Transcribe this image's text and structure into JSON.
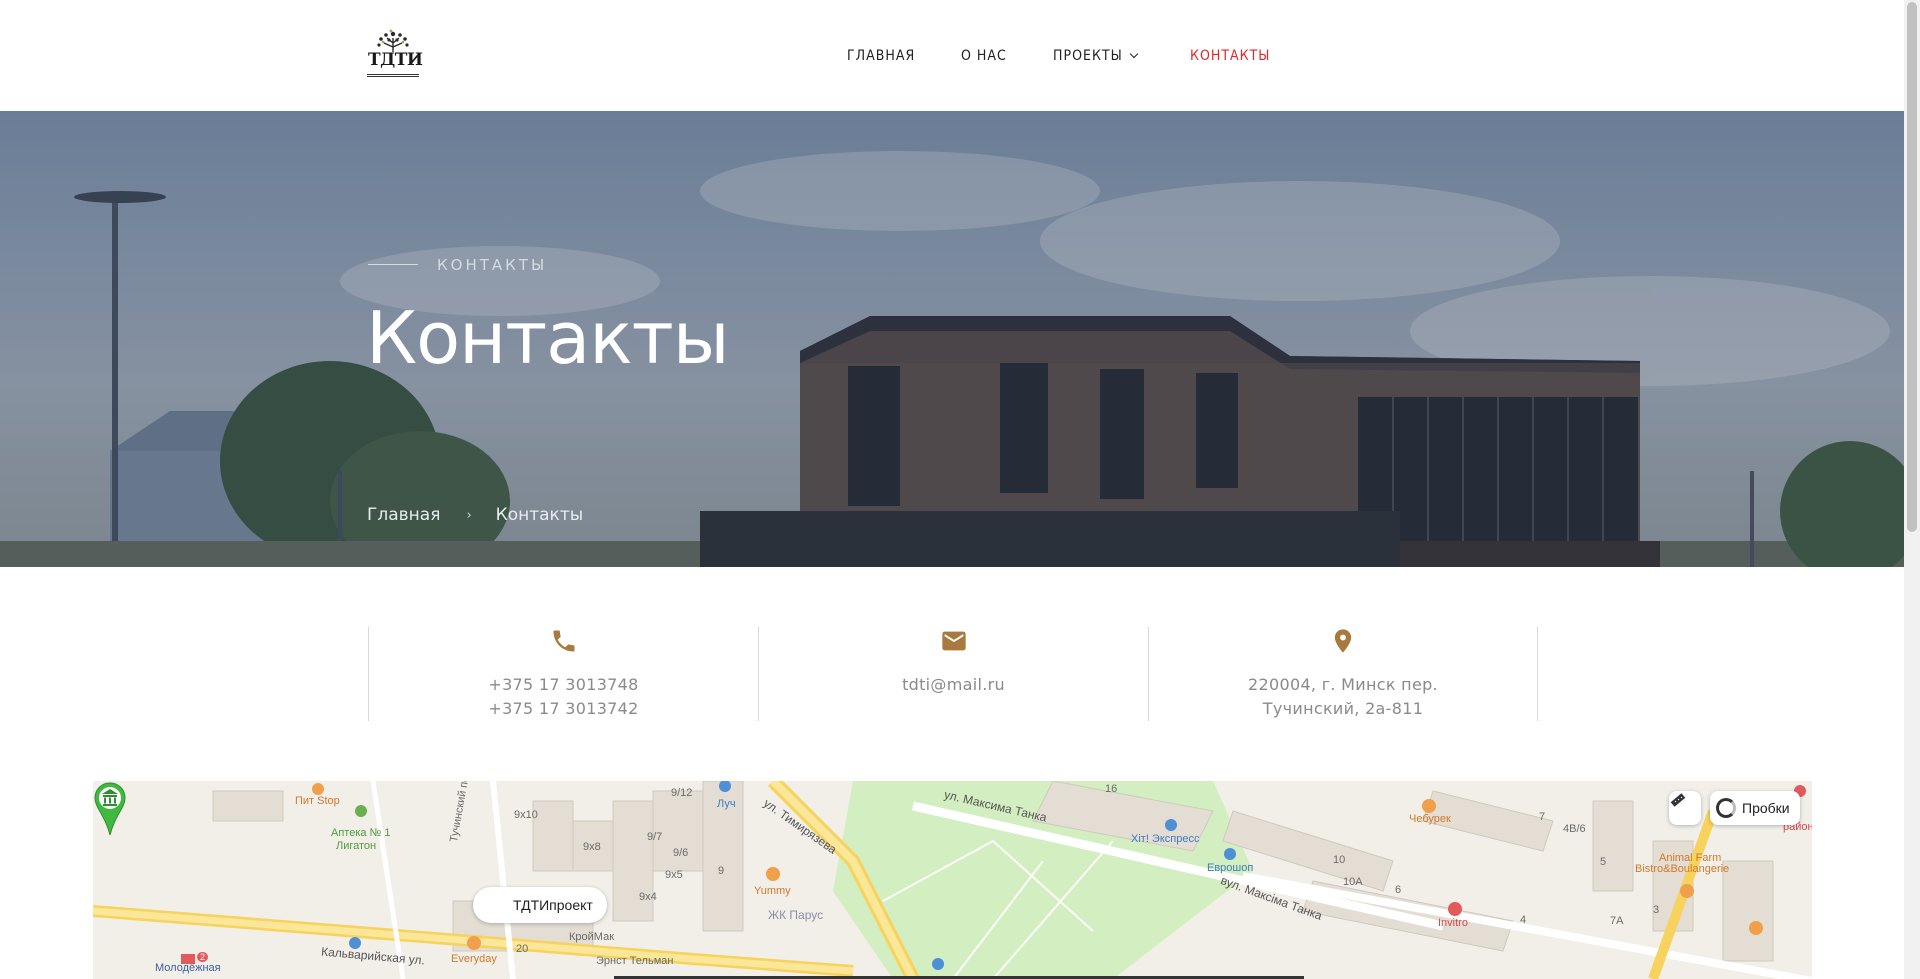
{
  "header": {
    "logo_text": "ТДТИ",
    "nav": [
      {
        "label": "ГЛАВНАЯ",
        "active": false
      },
      {
        "label": "О НАС",
        "active": false
      },
      {
        "label": "ПРОЕКТЫ",
        "active": false,
        "has_dropdown": true
      },
      {
        "label": "КОНТАКТЫ",
        "active": true
      }
    ],
    "active_color": "#e0262b"
  },
  "hero": {
    "kicker": "КОНТАКТЫ",
    "title": "Контакты",
    "breadcrumb": {
      "home": "Главная",
      "separator": "›",
      "current": "Контакты"
    }
  },
  "contacts": {
    "icon_color": "#a87a3d",
    "phone": {
      "icon": "phone-icon",
      "lines": [
        "+375 17 3013748",
        "+375 17 3013742"
      ]
    },
    "email": {
      "icon": "mail-icon",
      "lines": [
        "tdti@mail.ru"
      ]
    },
    "address": {
      "icon": "location-pin-icon",
      "lines": [
        "220004, г. Минск пер.",
        "Тучинский, 2а-811"
      ]
    }
  },
  "map": {
    "place_name": "ТДТИпроект",
    "traffic_label": "Пробки",
    "labels": {
      "pit_stop": "Пит Stop",
      "apteka": "Аптека № 1",
      "ligaton": "Лигатон",
      "tuchinsky": "Тучинский пер.",
      "h9x10": "9х10",
      "h9x8": "9х8",
      "h9x7": "9/7",
      "h9x6": "9/6",
      "h9x5": "9х5",
      "h9x4": "9х4",
      "h9_12": "9/12",
      "h9": "9",
      "h20": "20",
      "luch": "Луч",
      "yummy": "Yummy",
      "zhk_parus": "ЖК Парус",
      "kroymak": "КройМак",
      "ernst": "Эрнст Тельман",
      "everyday": "Everyday",
      "kalvariyskaya": "Кальварийская ул.",
      "molodezhnaya": "Молодёжная",
      "metro_line": "2",
      "timiryazeva": "ул. Тимирязева",
      "m_tanka": "ул. Максима Танка",
      "m_tanka_by": "вул. Максіма Танка",
      "hit_express": "Хіт! Экспресс",
      "evroshop": "Еврошоп",
      "cheburek": "Чебурек",
      "invitro": "Invitro",
      "animal_farm_1": "Animal Farm",
      "animal_farm_2": "Bistro&Boulangerie",
      "h16": "16",
      "h4b6": "4В/6",
      "h10": "10",
      "h10a": "10А",
      "h6": "6",
      "h4": "4",
      "h5": "5",
      "h7": "7",
      "h3": "3",
      "h7a": "7А",
      "rayon": "район"
    }
  }
}
